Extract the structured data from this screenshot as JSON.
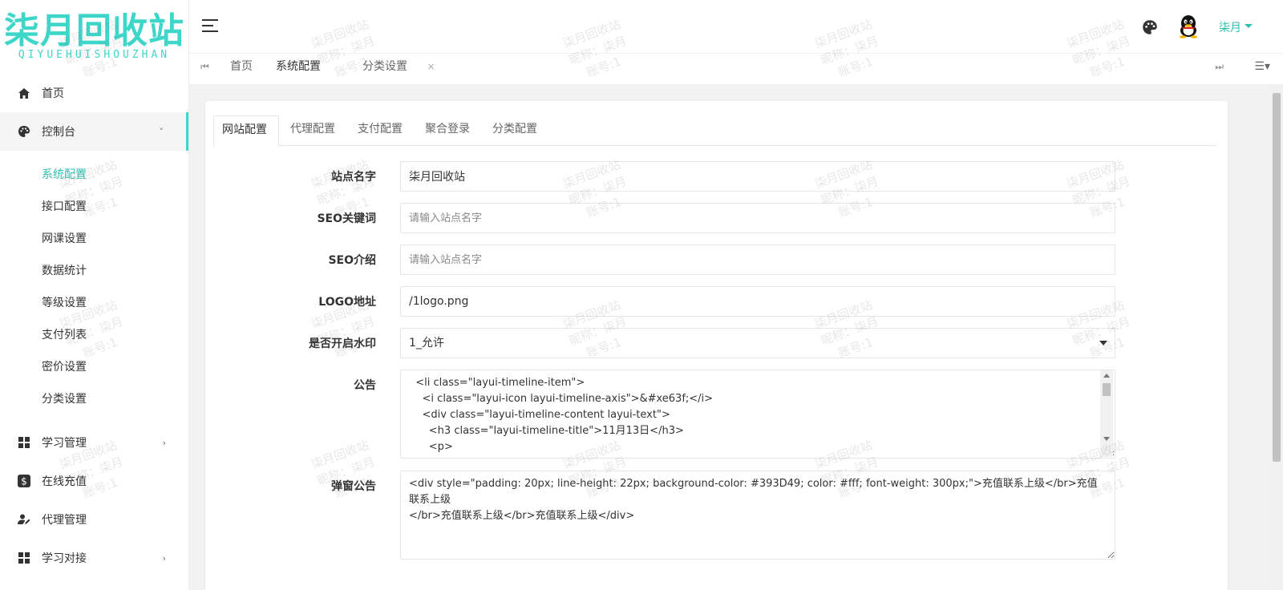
{
  "brand": {
    "title": "柒月回收站",
    "subtitle": "QIYUEHUISHOUZHAN"
  },
  "sidebar": {
    "items": [
      {
        "label": "首页",
        "icon": "home-icon"
      },
      {
        "label": "控制台",
        "icon": "palette-icon",
        "arrow": "˅"
      },
      {
        "label": "学习管理",
        "icon": "grid-icon",
        "arrow": "›"
      },
      {
        "label": "在线充值",
        "icon": "dollar-icon"
      },
      {
        "label": "代理管理",
        "icon": "user-edit-icon"
      },
      {
        "label": "学习对接",
        "icon": "grid-icon",
        "arrow": "›"
      }
    ],
    "submenu": [
      "系统配置",
      "接口配置",
      "网课设置",
      "数据统计",
      "等级设置",
      "支付列表",
      "密价设置",
      "分类设置"
    ]
  },
  "header": {
    "user": "柒月"
  },
  "tabs": {
    "items": [
      {
        "label": "首页"
      },
      {
        "label": "系统配置"
      },
      {
        "label": "分类设置",
        "close": "×"
      }
    ]
  },
  "subtabs": [
    "网站配置",
    "代理配置",
    "支付配置",
    "聚合登录",
    "分类配置"
  ],
  "form": {
    "site_name_label": "站点名字",
    "site_name_value": "柒月回收站",
    "seo_keywords_label": "SEO关键词",
    "seo_keywords_placeholder": "请输入站点名字",
    "seo_intro_label": "SEO介绍",
    "seo_intro_placeholder": "请输入站点名字",
    "logo_label": "LOGO地址",
    "logo_value": "/1logo.png",
    "watermark_label": "是否开启水印",
    "watermark_value": "1_允许",
    "notice_label": "公告",
    "notice_value": "  <li class=\"layui-timeline-item\">\n    <i class=\"layui-icon layui-timeline-axis\">&#xe63f;</i>\n    <div class=\"layui-timeline-content layui-text\">\n      <h3 class=\"layui-timeline-title\">11月13日</h3>\n      <p>\n        ",
    "popup_label": "弹窗公告",
    "popup_value": "<div style=\"padding: 20px; line-height: 22px; background-color: #393D49; color: #fff; font-weight: 300px;\">充值联系上级</br>充值联系上级\n</br>充值联系上级</br>充值联系上级</div>"
  },
  "watermark": {
    "line1": "柒月回收站",
    "line2": "昵称：柒月",
    "line3": "账号:1"
  },
  "colors": {
    "accent": "#3dd6c9",
    "active_text": "#2fbfb0"
  }
}
